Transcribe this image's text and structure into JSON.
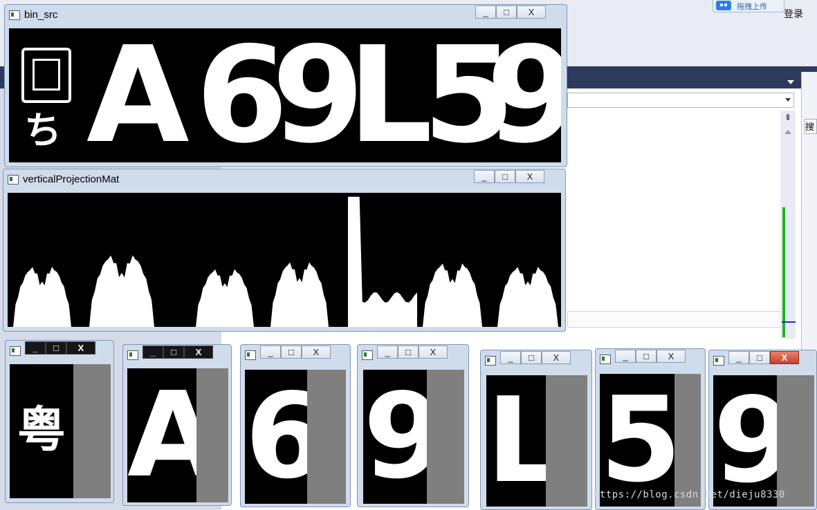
{
  "top_right": {
    "upload_label": "拖拽上传",
    "login_label": "登录",
    "search_char": "搜"
  },
  "watermark": "https://blog.csdn.net/dieju8330",
  "windows": {
    "bin_src": {
      "title": "bin_src",
      "plate_chars": [
        "A",
        "6",
        "9",
        "L",
        "5",
        "9"
      ]
    },
    "projection": {
      "title": "verticalProjectionMat"
    },
    "controls": {
      "minimize": "_",
      "maximize": "□",
      "close": "X"
    }
  },
  "segments": [
    "粤",
    "A",
    "6",
    "9",
    "L",
    "5",
    "9"
  ],
  "chart_data": {
    "type": "area",
    "title": "verticalProjectionMat",
    "xlabel": "",
    "ylabel": "",
    "groups": [
      {
        "char": "粤",
        "peak": 0.52
      },
      {
        "char": "A",
        "peak": 0.62
      },
      {
        "char": "6",
        "peak": 0.5
      },
      {
        "char": "9",
        "peak": 0.56
      },
      {
        "char": "L",
        "peak": 0.97
      },
      {
        "char": "5",
        "peak": 0.55
      },
      {
        "char": "9",
        "peak": 0.52
      }
    ]
  },
  "colors": {
    "window_frame": "#cfdcec",
    "close_active": "#c7402c",
    "editor_green": "#1fb51f"
  }
}
